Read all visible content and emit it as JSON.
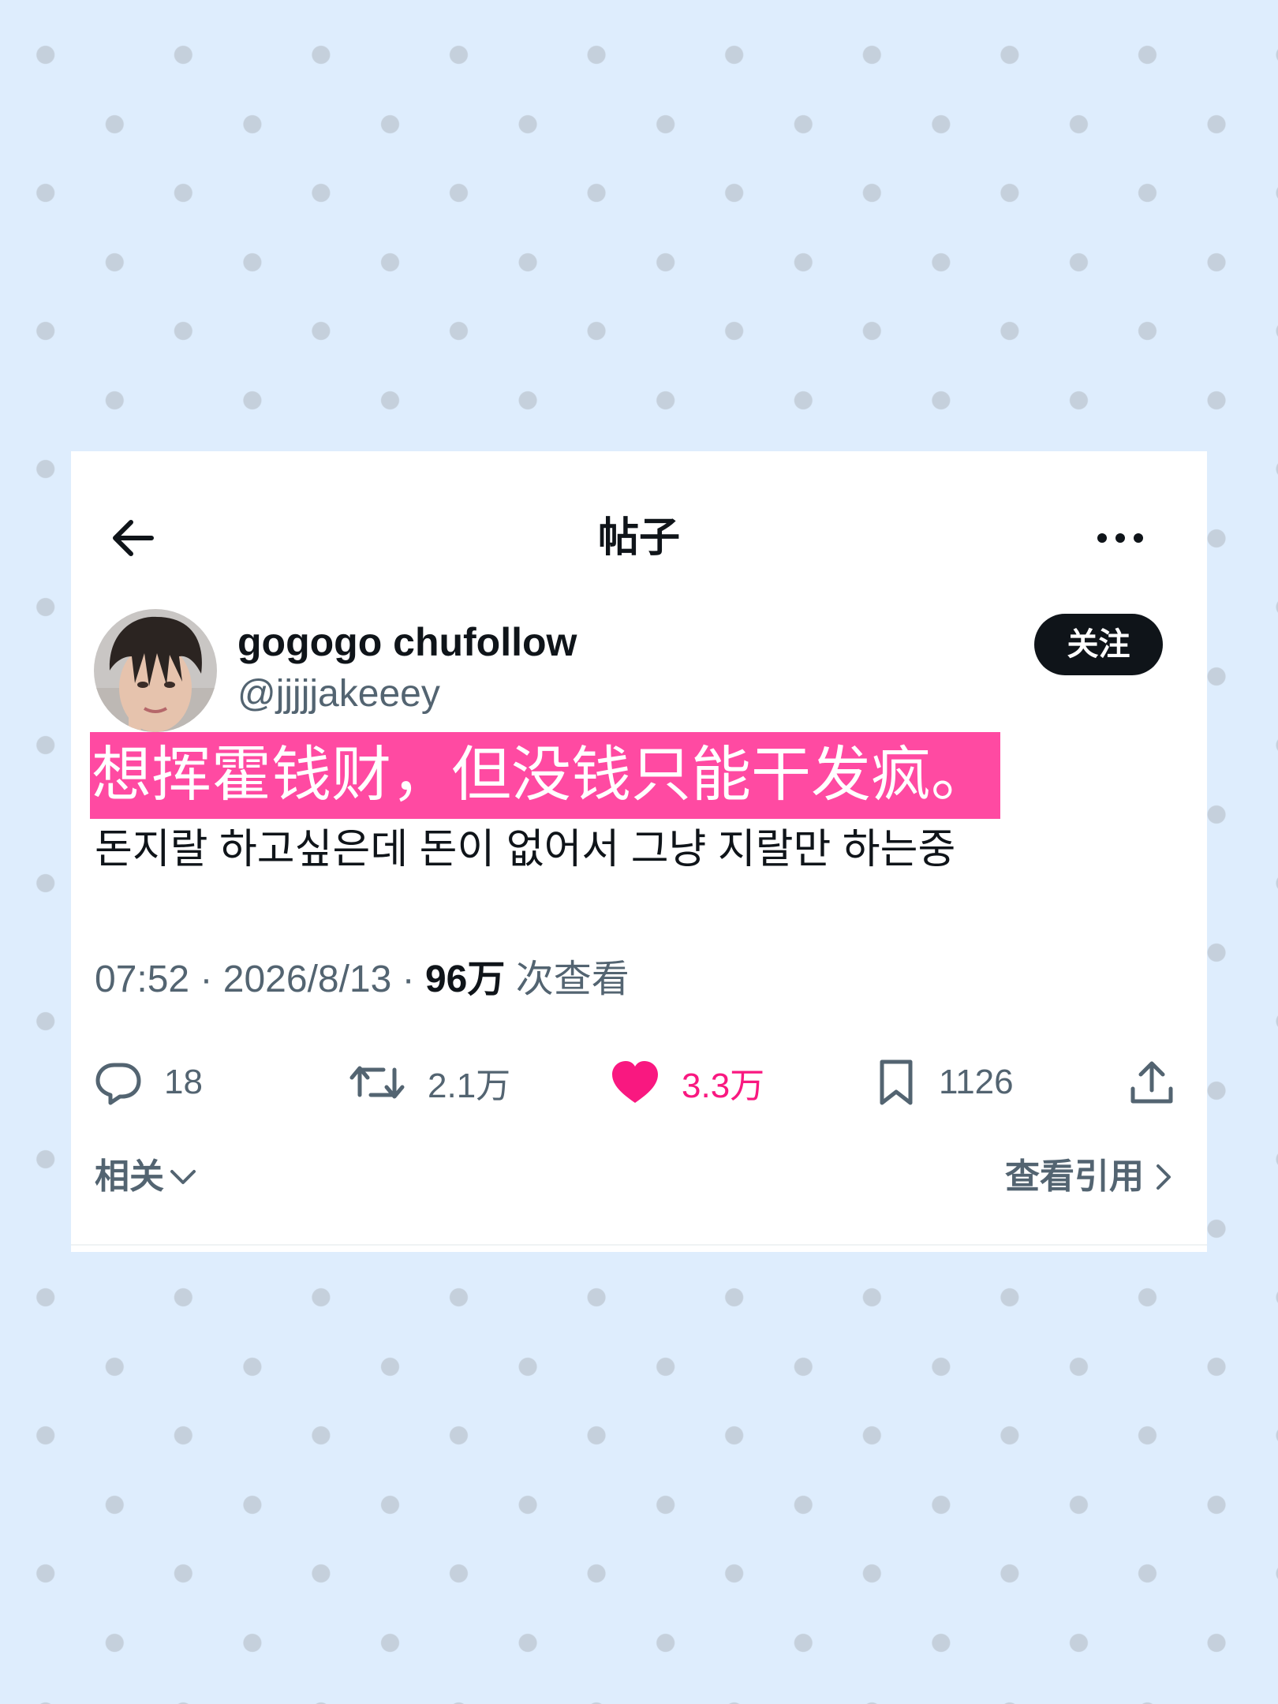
{
  "header": {
    "title": "帖子",
    "back_icon": "arrow-left-icon",
    "more_icon": "more-horizontal-icon"
  },
  "author": {
    "display_name": "gogogo chufollow",
    "handle": "@jjjjjakeeey",
    "follow_label": "关注"
  },
  "post": {
    "main_text": "想挥霍钱财，但没钱只能干发疯。",
    "sub_text": "돈지랄 하고싶은데 돈이 없어서 그냥 지랄만 하는중",
    "highlight_color": "#ff4aa2"
  },
  "meta": {
    "time": "07:52",
    "separator": " · ",
    "date": "2026/8/13",
    "views_count": "96万",
    "views_label": " 次查看"
  },
  "actions": {
    "reply": {
      "icon": "comment-icon",
      "count": "18"
    },
    "repost": {
      "icon": "repost-icon",
      "count": "2.1万"
    },
    "like": {
      "icon": "heart-icon",
      "count": "3.3万",
      "color": "#f91880",
      "active": true
    },
    "bookmark": {
      "icon": "bookmark-icon",
      "count": "1126"
    },
    "share": {
      "icon": "share-icon"
    }
  },
  "footer": {
    "related_label": "相关",
    "view_quotes_label": "查看引用"
  },
  "colors": {
    "background": "#deedfd",
    "dots": "#c5d0dc",
    "text_primary": "#0f1419",
    "text_secondary": "#536471",
    "like": "#f91880"
  }
}
